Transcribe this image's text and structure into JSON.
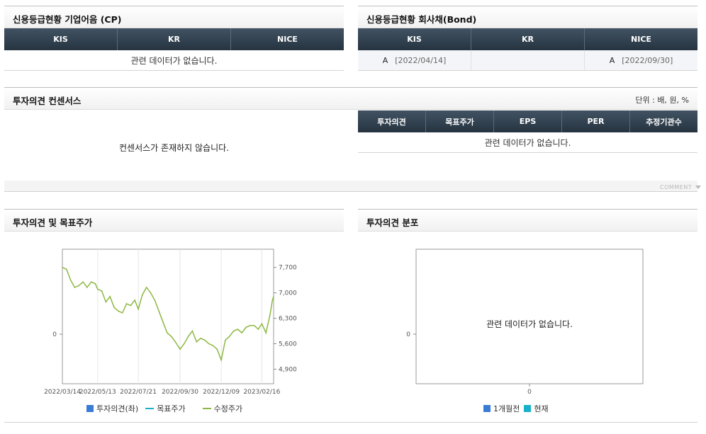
{
  "credit_cp": {
    "title": "신용등급현황 기업어음 (CP)",
    "columns": [
      "KIS",
      "KR",
      "NICE"
    ],
    "empty_msg": "관련 데이터가 없습니다."
  },
  "credit_bond": {
    "title": "신용등급현황 회사채(Bond)",
    "columns": [
      "KIS",
      "KR",
      "NICE"
    ],
    "cells": [
      {
        "grade": "A",
        "date": "[2022/04/14]"
      },
      {
        "grade": "",
        "date": ""
      },
      {
        "grade": "A",
        "date": "[2022/09/30]"
      }
    ]
  },
  "consensus": {
    "title": "투자의견 컨센서스",
    "unit": "단위 : 배, 원, %",
    "empty_msg": "컨센서스가 존재하지 않습니다.",
    "columns": [
      "투자의견",
      "목표주가",
      "EPS",
      "PER",
      "추정기관수"
    ],
    "table_empty_msg": "관련 데이터가 없습니다.",
    "comment_label": "COMMENT",
    "comment_icon": "triangle-down-icon"
  },
  "opinion_chart": {
    "title": "투자의견 및 목표주가",
    "legend": [
      "투자의견(좌)",
      "목표주가",
      "수정주가"
    ],
    "colors": {
      "opinion": "#3a7bd5",
      "target": "#1ab0c8",
      "price": "#8db843"
    }
  },
  "distribution_chart": {
    "title": "투자의견 분포",
    "empty_msg": "관련 데이터가 없습니다.",
    "legend": [
      "1개월전",
      "현재"
    ],
    "colors": {
      "month_ago": "#3a7bd5",
      "current": "#1ab0c8"
    }
  },
  "chart_data": [
    {
      "type": "line",
      "title": "",
      "x_ticks": [
        "2022/03/14",
        "2022/05/13",
        "2022/07/21",
        "2022/09/30",
        "2022/12/09",
        "2023/02/16"
      ],
      "y_left_ticks": [
        "0"
      ],
      "y_right_ticks": [
        "7,700",
        "7,000",
        "6,300",
        "5,600",
        "4,900"
      ],
      "y_right_range": [
        4500,
        8200
      ],
      "series": [
        {
          "name": "수정주가",
          "x": [
            "2022/03/14",
            "2022/03/21",
            "2022/03/28",
            "2022/04/04",
            "2022/04/11",
            "2022/04/18",
            "2022/04/25",
            "2022/05/02",
            "2022/05/09",
            "2022/05/13",
            "2022/05/20",
            "2022/05/27",
            "2022/06/03",
            "2022/06/10",
            "2022/06/17",
            "2022/06/24",
            "2022/07/01",
            "2022/07/08",
            "2022/07/15",
            "2022/07/21",
            "2022/07/28",
            "2022/08/04",
            "2022/08/11",
            "2022/08/18",
            "2022/08/25",
            "2022/09/01",
            "2022/09/08",
            "2022/09/15",
            "2022/09/22",
            "2022/09/30",
            "2022/10/07",
            "2022/10/14",
            "2022/10/21",
            "2022/10/28",
            "2022/11/04",
            "2022/11/11",
            "2022/11/18",
            "2022/11/25",
            "2022/12/02",
            "2022/12/09",
            "2022/12/16",
            "2022/12/23",
            "2022/12/30",
            "2023/01/06",
            "2023/01/13",
            "2023/01/20",
            "2023/01/27",
            "2023/02/03",
            "2023/02/10",
            "2023/02/16",
            "2023/02/23",
            "2023/03/02",
            "2023/03/06",
            "2023/03/08"
          ],
          "y": [
            7700,
            7650,
            7350,
            7150,
            7200,
            7300,
            7150,
            7300,
            7250,
            7100,
            7050,
            6750,
            6900,
            6600,
            6500,
            6450,
            6700,
            6650,
            6800,
            6550,
            6950,
            7150,
            7000,
            6800,
            6500,
            6200,
            5900,
            5800,
            5650,
            5450,
            5600,
            5800,
            5950,
            5650,
            5750,
            5700,
            5600,
            5550,
            5450,
            5150,
            5700,
            5800,
            5950,
            6000,
            5900,
            6050,
            6100,
            6100,
            6000,
            6150,
            5900,
            6400,
            6800,
            6900
          ]
        }
      ]
    },
    {
      "type": "bar",
      "title": "",
      "categories": [
        "0"
      ],
      "y_ticks": [
        "0"
      ],
      "series": [
        {
          "name": "1개월전",
          "values": []
        },
        {
          "name": "현재",
          "values": []
        }
      ]
    }
  ]
}
